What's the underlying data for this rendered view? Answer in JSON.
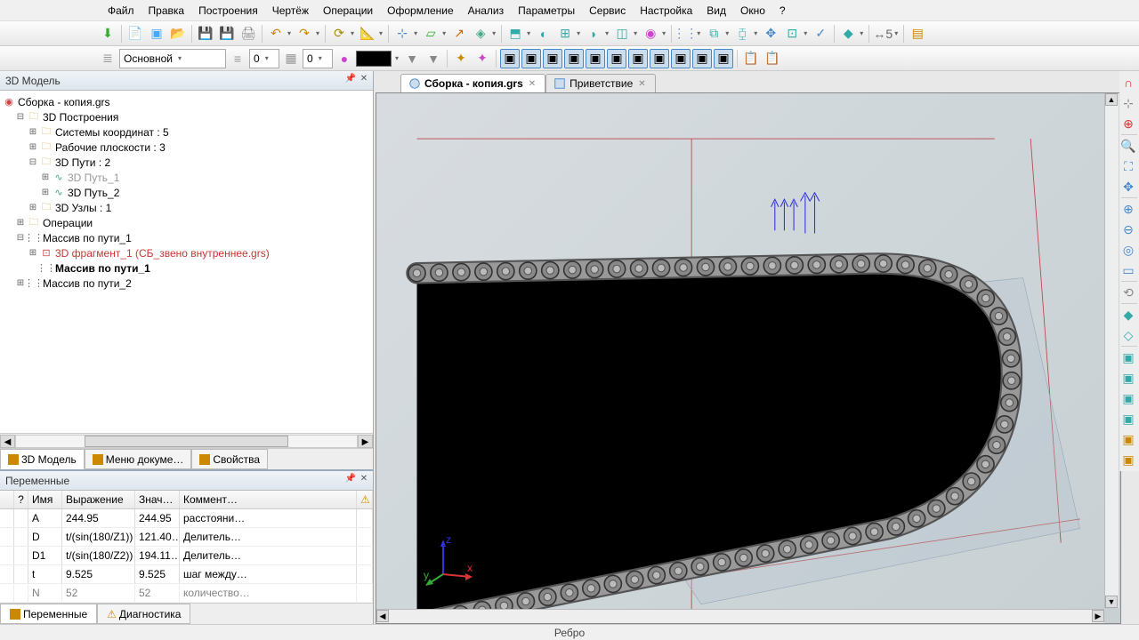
{
  "menu": {
    "file": "Файл",
    "edit": "Правка",
    "construct": "Построения",
    "drawing": "Чертёж",
    "operations": "Операции",
    "design": "Оформление",
    "analysis": "Анализ",
    "parameters": "Параметры",
    "service": "Сервис",
    "setup": "Настройка",
    "view": "Вид",
    "window": "Окно",
    "help": "?"
  },
  "toolbar2": {
    "layer_combo": "Основной",
    "spin1": "0",
    "spin2": "0",
    "color_swatch": "#000000"
  },
  "panel_model": {
    "title": "3D Модель"
  },
  "tree": {
    "root": "Сборка - копия.grs",
    "n1": "3D Построения",
    "n1_1": "Системы координат : 5",
    "n1_2": "Рабочие плоскости : 3",
    "n1_3": "3D Пути : 2",
    "n1_3_1": "3D Путь_1",
    "n1_3_2": "3D Путь_2",
    "n1_4": "3D Узлы : 1",
    "n2": "Операции",
    "n3": "Массив по пути_1",
    "n3_1": "3D фрагмент_1 (СБ_звено внутреннее.grs)",
    "n3_2": "Массив по пути_1",
    "n4": "Массив по пути_2"
  },
  "left_tabs": {
    "model": "3D Модель",
    "docmenu": "Меню докуме…",
    "props": "Свойства"
  },
  "panel_vars": {
    "title": "Переменные"
  },
  "vars_header": {
    "h0": "",
    "h1": "?",
    "h2": "Имя",
    "h3": "Выражение",
    "h4": "Знач…",
    "h5": "Коммент…",
    "h6": ""
  },
  "vars_rows": [
    {
      "name": "A",
      "expr": "244.95",
      "val": "244.95",
      "comm": "расстояни…"
    },
    {
      "name": "D",
      "expr": "t/(sin(180/Z1))",
      "val": "121.40…",
      "comm": "Делитель…"
    },
    {
      "name": "D1",
      "expr": "t/(sin(180/Z2))",
      "val": "194.11…",
      "comm": "Делитель…"
    },
    {
      "name": "t",
      "expr": "9.525",
      "val": "9.525",
      "comm": "шаг между…"
    },
    {
      "name": "N",
      "expr": "52",
      "val": "52",
      "comm": "количество…"
    }
  ],
  "bottom_tabs": {
    "vars": "Переменные",
    "diag": "Диагностика"
  },
  "doc_tabs": {
    "t1": "Сборка - копия.grs",
    "t2": "Приветствие"
  },
  "status": "Ребро",
  "axis": {
    "x": "x",
    "y": "y",
    "z": "z"
  }
}
